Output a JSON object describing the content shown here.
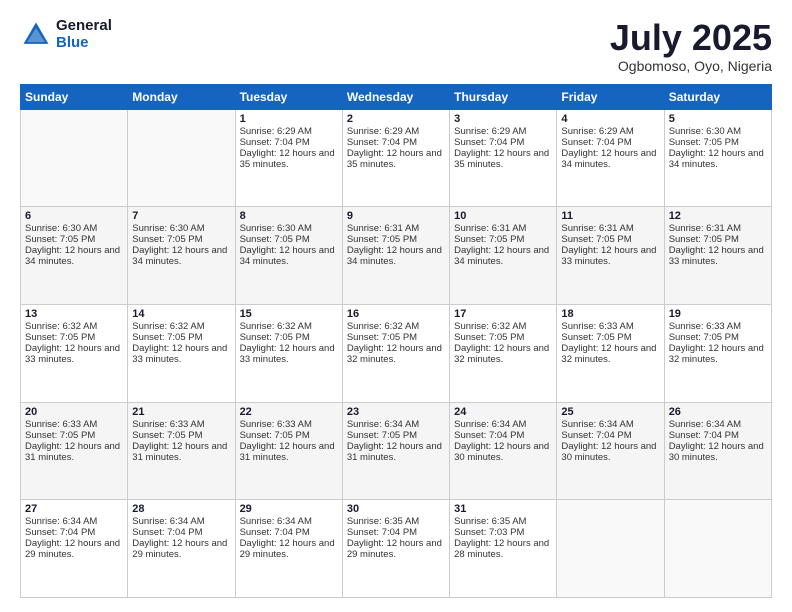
{
  "logo": {
    "general": "General",
    "blue": "Blue"
  },
  "header": {
    "month": "July 2025",
    "location": "Ogbomoso, Oyo, Nigeria"
  },
  "days_of_week": [
    "Sunday",
    "Monday",
    "Tuesday",
    "Wednesday",
    "Thursday",
    "Friday",
    "Saturday"
  ],
  "weeks": [
    [
      {
        "day": "",
        "sunrise": "",
        "sunset": "",
        "daylight": ""
      },
      {
        "day": "",
        "sunrise": "",
        "sunset": "",
        "daylight": ""
      },
      {
        "day": "1",
        "sunrise": "Sunrise: 6:29 AM",
        "sunset": "Sunset: 7:04 PM",
        "daylight": "Daylight: 12 hours and 35 minutes."
      },
      {
        "day": "2",
        "sunrise": "Sunrise: 6:29 AM",
        "sunset": "Sunset: 7:04 PM",
        "daylight": "Daylight: 12 hours and 35 minutes."
      },
      {
        "day": "3",
        "sunrise": "Sunrise: 6:29 AM",
        "sunset": "Sunset: 7:04 PM",
        "daylight": "Daylight: 12 hours and 35 minutes."
      },
      {
        "day": "4",
        "sunrise": "Sunrise: 6:29 AM",
        "sunset": "Sunset: 7:04 PM",
        "daylight": "Daylight: 12 hours and 34 minutes."
      },
      {
        "day": "5",
        "sunrise": "Sunrise: 6:30 AM",
        "sunset": "Sunset: 7:05 PM",
        "daylight": "Daylight: 12 hours and 34 minutes."
      }
    ],
    [
      {
        "day": "6",
        "sunrise": "Sunrise: 6:30 AM",
        "sunset": "Sunset: 7:05 PM",
        "daylight": "Daylight: 12 hours and 34 minutes."
      },
      {
        "day": "7",
        "sunrise": "Sunrise: 6:30 AM",
        "sunset": "Sunset: 7:05 PM",
        "daylight": "Daylight: 12 hours and 34 minutes."
      },
      {
        "day": "8",
        "sunrise": "Sunrise: 6:30 AM",
        "sunset": "Sunset: 7:05 PM",
        "daylight": "Daylight: 12 hours and 34 minutes."
      },
      {
        "day": "9",
        "sunrise": "Sunrise: 6:31 AM",
        "sunset": "Sunset: 7:05 PM",
        "daylight": "Daylight: 12 hours and 34 minutes."
      },
      {
        "day": "10",
        "sunrise": "Sunrise: 6:31 AM",
        "sunset": "Sunset: 7:05 PM",
        "daylight": "Daylight: 12 hours and 34 minutes."
      },
      {
        "day": "11",
        "sunrise": "Sunrise: 6:31 AM",
        "sunset": "Sunset: 7:05 PM",
        "daylight": "Daylight: 12 hours and 33 minutes."
      },
      {
        "day": "12",
        "sunrise": "Sunrise: 6:31 AM",
        "sunset": "Sunset: 7:05 PM",
        "daylight": "Daylight: 12 hours and 33 minutes."
      }
    ],
    [
      {
        "day": "13",
        "sunrise": "Sunrise: 6:32 AM",
        "sunset": "Sunset: 7:05 PM",
        "daylight": "Daylight: 12 hours and 33 minutes."
      },
      {
        "day": "14",
        "sunrise": "Sunrise: 6:32 AM",
        "sunset": "Sunset: 7:05 PM",
        "daylight": "Daylight: 12 hours and 33 minutes."
      },
      {
        "day": "15",
        "sunrise": "Sunrise: 6:32 AM",
        "sunset": "Sunset: 7:05 PM",
        "daylight": "Daylight: 12 hours and 33 minutes."
      },
      {
        "day": "16",
        "sunrise": "Sunrise: 6:32 AM",
        "sunset": "Sunset: 7:05 PM",
        "daylight": "Daylight: 12 hours and 32 minutes."
      },
      {
        "day": "17",
        "sunrise": "Sunrise: 6:32 AM",
        "sunset": "Sunset: 7:05 PM",
        "daylight": "Daylight: 12 hours and 32 minutes."
      },
      {
        "day": "18",
        "sunrise": "Sunrise: 6:33 AM",
        "sunset": "Sunset: 7:05 PM",
        "daylight": "Daylight: 12 hours and 32 minutes."
      },
      {
        "day": "19",
        "sunrise": "Sunrise: 6:33 AM",
        "sunset": "Sunset: 7:05 PM",
        "daylight": "Daylight: 12 hours and 32 minutes."
      }
    ],
    [
      {
        "day": "20",
        "sunrise": "Sunrise: 6:33 AM",
        "sunset": "Sunset: 7:05 PM",
        "daylight": "Daylight: 12 hours and 31 minutes."
      },
      {
        "day": "21",
        "sunrise": "Sunrise: 6:33 AM",
        "sunset": "Sunset: 7:05 PM",
        "daylight": "Daylight: 12 hours and 31 minutes."
      },
      {
        "day": "22",
        "sunrise": "Sunrise: 6:33 AM",
        "sunset": "Sunset: 7:05 PM",
        "daylight": "Daylight: 12 hours and 31 minutes."
      },
      {
        "day": "23",
        "sunrise": "Sunrise: 6:34 AM",
        "sunset": "Sunset: 7:05 PM",
        "daylight": "Daylight: 12 hours and 31 minutes."
      },
      {
        "day": "24",
        "sunrise": "Sunrise: 6:34 AM",
        "sunset": "Sunset: 7:04 PM",
        "daylight": "Daylight: 12 hours and 30 minutes."
      },
      {
        "day": "25",
        "sunrise": "Sunrise: 6:34 AM",
        "sunset": "Sunset: 7:04 PM",
        "daylight": "Daylight: 12 hours and 30 minutes."
      },
      {
        "day": "26",
        "sunrise": "Sunrise: 6:34 AM",
        "sunset": "Sunset: 7:04 PM",
        "daylight": "Daylight: 12 hours and 30 minutes."
      }
    ],
    [
      {
        "day": "27",
        "sunrise": "Sunrise: 6:34 AM",
        "sunset": "Sunset: 7:04 PM",
        "daylight": "Daylight: 12 hours and 29 minutes."
      },
      {
        "day": "28",
        "sunrise": "Sunrise: 6:34 AM",
        "sunset": "Sunset: 7:04 PM",
        "daylight": "Daylight: 12 hours and 29 minutes."
      },
      {
        "day": "29",
        "sunrise": "Sunrise: 6:34 AM",
        "sunset": "Sunset: 7:04 PM",
        "daylight": "Daylight: 12 hours and 29 minutes."
      },
      {
        "day": "30",
        "sunrise": "Sunrise: 6:35 AM",
        "sunset": "Sunset: 7:04 PM",
        "daylight": "Daylight: 12 hours and 29 minutes."
      },
      {
        "day": "31",
        "sunrise": "Sunrise: 6:35 AM",
        "sunset": "Sunset: 7:03 PM",
        "daylight": "Daylight: 12 hours and 28 minutes."
      },
      {
        "day": "",
        "sunrise": "",
        "sunset": "",
        "daylight": ""
      },
      {
        "day": "",
        "sunrise": "",
        "sunset": "",
        "daylight": ""
      }
    ]
  ]
}
